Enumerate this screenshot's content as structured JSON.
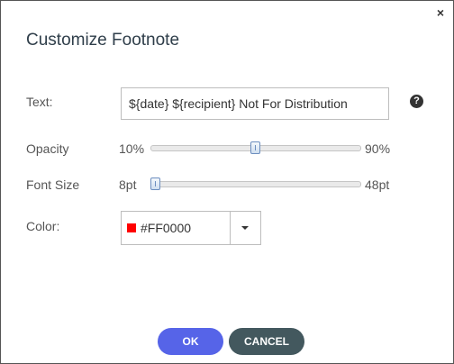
{
  "dialog": {
    "title": "Customize Footnote",
    "close_glyph": "×"
  },
  "fields": {
    "text": {
      "label": "Text:",
      "value": "${date} ${recipient} Not For Distribution",
      "help_glyph": "?"
    },
    "opacity": {
      "label": "Opacity",
      "min_label": "10%",
      "max_label": "90%",
      "value_percent": 50
    },
    "font_size": {
      "label": "Font Size",
      "min_label": "8pt",
      "max_label": "48pt",
      "value_pt": 8
    },
    "color": {
      "label": "Color:",
      "value": "#FF0000",
      "swatch": "#FF0000"
    }
  },
  "buttons": {
    "ok": "OK",
    "cancel": "CANCEL"
  },
  "icons": {
    "close": "close-icon",
    "help": "help-icon",
    "dropdown": "chevron-down-icon"
  }
}
